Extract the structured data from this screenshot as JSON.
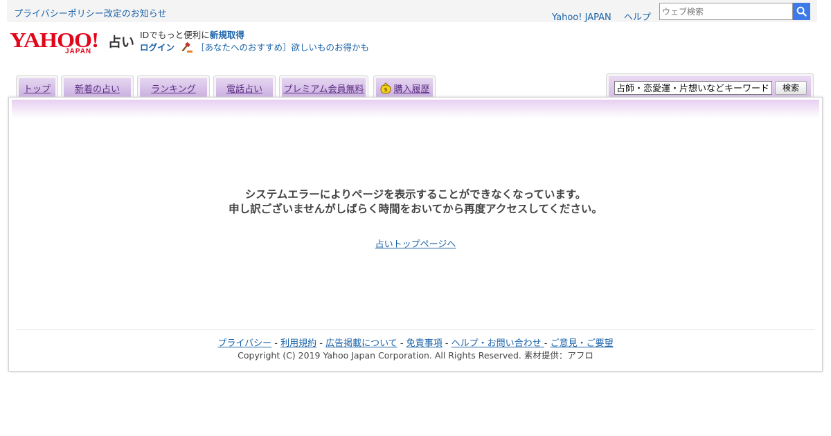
{
  "topbar": {
    "notice": "プライバシーポリシー改定のお知らせ",
    "links": [
      "Yahoo! JAPAN",
      "ヘルプ"
    ],
    "search_placeholder": "ウェブ検索"
  },
  "header": {
    "logo_text": "YAHOO!",
    "logo_sub": "JAPAN",
    "service_name": "占い",
    "id_text": "IDでもっと便利に",
    "signup_label": "新規取得",
    "login_label": "ログイン",
    "promo_text": "［あなたへのおすすめ］欲しいものお得かも"
  },
  "tabs": [
    "トップ",
    "新着の占い",
    "ランキング",
    "電話占い",
    "プレミアム会員無料",
    "購入履歴"
  ],
  "search": {
    "placeholder": "占師・恋愛運・片想いなどキーワード",
    "button": "検索"
  },
  "main": {
    "error_line1": "システムエラーによりページを表示することができなくなっています。",
    "error_line2": "申し訳ございませんがしばらく時間をおいてから再度アクセスしてください。",
    "top_link": "占いトップページへ"
  },
  "footer": {
    "links": [
      "プライバシー",
      "利用規約",
      "広告掲載について",
      "免責事項",
      "ヘルプ・お問い合わせ ",
      "ご意見・ご要望"
    ],
    "copyright": "Copyright (C) 2019 Yahoo Japan Corporation. All Rights Reserved. 素材提供：アフロ"
  },
  "colors": {
    "brand_red": "#e1061b",
    "link_blue": "#1b63a8",
    "tab_purple": "#c9aee0",
    "search_button_blue": "#3d7ae8"
  }
}
